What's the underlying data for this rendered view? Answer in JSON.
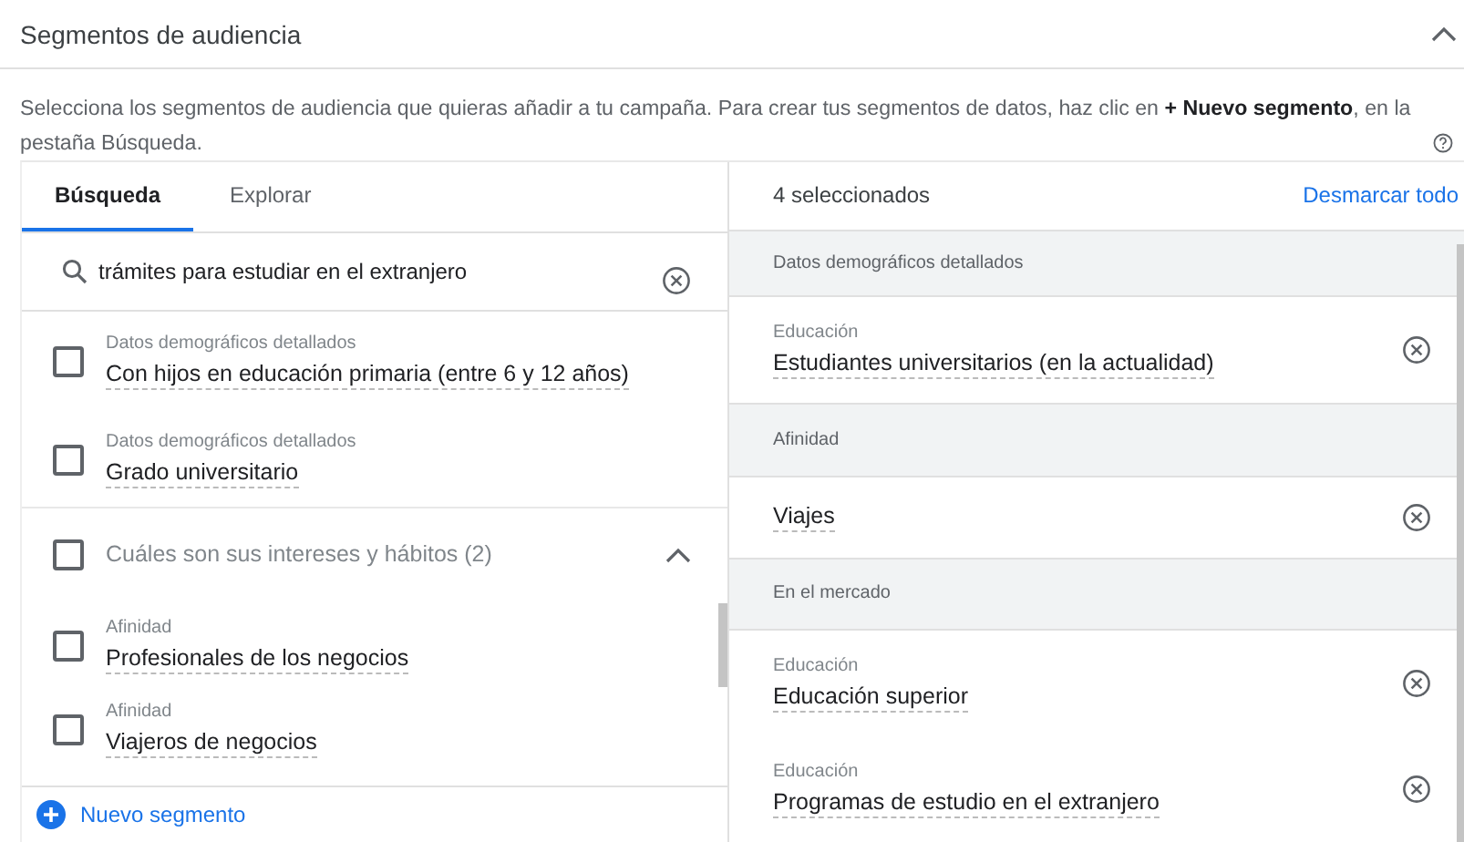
{
  "section": {
    "title": "Segmentos de audiencia",
    "expanded": true
  },
  "description": "Selecciona los segmentos de audiencia que quieras añadir a tu campaña. Para crear tus segmentos de datos, haz clic en **+ Nuevo segmento**, en la pestaña Búsqueda.",
  "tabs": [
    {
      "label": "Búsqueda",
      "selected": true
    },
    {
      "label": "Explorar",
      "selected": false
    }
  ],
  "search": {
    "value": "trámites para estudiar en el extranjero"
  },
  "results": [
    {
      "kind": "segment",
      "category": "Datos demográficos detallados",
      "label": "Con hijos en educación primaria (entre 6 y 12 años)",
      "checked": false
    },
    {
      "kind": "segment",
      "category": "Datos demográficos detallados",
      "label": "Grado universitario",
      "checked": false
    },
    {
      "kind": "group",
      "label": "Cuáles son sus intereses y hábitos (2)",
      "checked": false,
      "expanded": true
    },
    {
      "kind": "segment",
      "category": "Afinidad",
      "label": "Profesionales de los negocios",
      "checked": false
    },
    {
      "kind": "segment",
      "category": "Afinidad",
      "label": "Viajeros de negocios",
      "checked": false
    }
  ],
  "new_segment": "Nuevo segmento",
  "selected_panel": {
    "count": "4 seleccionados",
    "clear": "Desmarcar todo",
    "items": [
      {
        "kind": "group",
        "label": "Datos demográficos detallados"
      },
      {
        "kind": "segment",
        "category": "Educación",
        "label": "Estudiantes universitarios (en la actualidad)"
      },
      {
        "kind": "group",
        "label": "Afinidad"
      },
      {
        "kind": "segment",
        "label": "Viajes"
      },
      {
        "kind": "group",
        "label": "En el mercado"
      },
      {
        "kind": "segment",
        "category": "Educación",
        "label": "Educación superior"
      },
      {
        "kind": "segment",
        "category": "Educación",
        "label": "Programas de estudio en el extranjero"
      }
    ]
  }
}
